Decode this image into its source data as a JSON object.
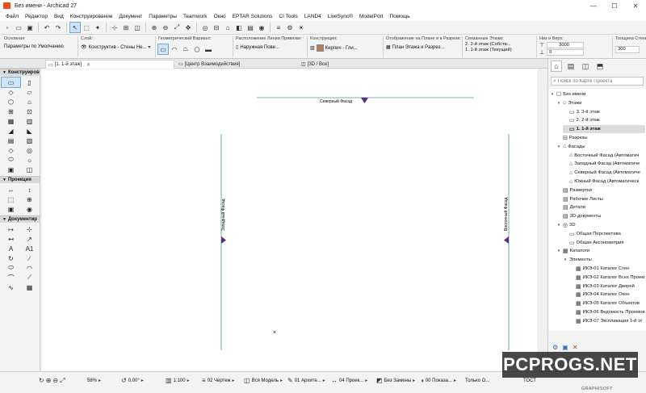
{
  "window": {
    "title": "Без имени - Archicad 27",
    "controls": [
      "—",
      "☐",
      "✕"
    ]
  },
  "menu": [
    "Файл",
    "Редактор",
    "Вид",
    "Конструирование",
    "Документ",
    "Параметры",
    "Teamwork",
    "Окно",
    "EPTAR Solutions",
    "CI Tools",
    "LAND4",
    "LiveSync®",
    "ModelPort",
    "Помощь"
  ],
  "infobox": {
    "groups": [
      {
        "label": "Основная:",
        "value": "Параметры по Умолчанию"
      },
      {
        "label": "Слой:",
        "value": "Конструктив - Стены Не..."
      },
      {
        "label": "Геометрический Вариант:",
        "value": ""
      },
      {
        "label": "Расположение Линии Привязки:",
        "value": "Наружная Пове..."
      },
      {
        "label": "Конструкция:",
        "value": "Кирпич - Гли..."
      },
      {
        "label": "Отображение на Плане и в Разрезе:",
        "value": "План Этажа и Разрез..."
      },
      {
        "label": "Связанные Этажи:",
        "value": "2. 2-й этаж (Собств...",
        "value2": "1. 1-й этаж (Текущий)"
      },
      {
        "label": "Низ и Верх:",
        "value": "3000",
        "value2": "0"
      },
      {
        "label": "Толщина Стены:",
        "value": "300"
      }
    ]
  },
  "tabs": [
    {
      "label": "[1. 1-й этаж]",
      "active": true
    },
    {
      "label": "[Центр Взаимодействия]",
      "active": false
    },
    {
      "label": "[3D / Все]",
      "active": false
    }
  ],
  "toolbox": {
    "sections": [
      {
        "title": "Конструиров",
        "tools": [
          "▭",
          "▯",
          "◇",
          "▱",
          "⬡",
          "⌂",
          "⊞",
          "⊡",
          "▦",
          "▥",
          "◢",
          "◣",
          "▤",
          "▧",
          "◇",
          "◎",
          "⬭",
          "☼",
          "▣",
          "◫"
        ]
      },
      {
        "title": "Проекция",
        "tools": [
          "↔",
          "↕",
          "⬚",
          "⊕",
          "▣",
          "◉"
        ]
      },
      {
        "title": "Документир",
        "tools": [
          "↦",
          "⊹",
          "↤",
          "↗",
          "A",
          "A1",
          "↻",
          "∕",
          "⬭",
          "◠",
          "⌒",
          "⟋",
          "∿",
          "▦"
        ]
      }
    ]
  },
  "canvas": {
    "labels": {
      "north": "Северный Фасад",
      "west": "Западный Фасад",
      "east": "Восточный Фасад"
    },
    "marker_color": "#5b2a86",
    "line_color": "#4a9a8c"
  },
  "navigator": {
    "search_placeholder": "Поиск по Карте Проекта",
    "items": [
      {
        "label": "Без имени",
        "level": 0,
        "icon": "☐",
        "toggle": "▾"
      },
      {
        "label": "Этажи",
        "level": 1,
        "icon": "⌂",
        "toggle": "▾"
      },
      {
        "label": "3. 3-й этаж",
        "level": 2,
        "icon": "▭",
        "toggle": ""
      },
      {
        "label": "2. 2-й этаж",
        "level": 2,
        "icon": "▭",
        "toggle": ""
      },
      {
        "label": "1. 1-й этаж",
        "level": 2,
        "icon": "▭",
        "toggle": "",
        "selected": true
      },
      {
        "label": "Разрезы",
        "level": 1,
        "icon": "⊟",
        "toggle": ""
      },
      {
        "label": "Фасады",
        "level": 1,
        "icon": "⌂",
        "toggle": "▾"
      },
      {
        "label": "Восточный Фасад (Автоматич",
        "level": 2,
        "icon": "⌂",
        "toggle": ""
      },
      {
        "label": "Западный Фасад (Автоматиче",
        "level": 2,
        "icon": "⌂",
        "toggle": ""
      },
      {
        "label": "Северный Фасад (Автоматиче",
        "level": 2,
        "icon": "⌂",
        "toggle": ""
      },
      {
        "label": "Южный Фасад (Автоматическ",
        "level": 2,
        "icon": "⌂",
        "toggle": ""
      },
      {
        "label": "Развертки",
        "level": 1,
        "icon": "▤",
        "toggle": ""
      },
      {
        "label": "Рабочие Листы",
        "level": 1,
        "icon": "▤",
        "toggle": ""
      },
      {
        "label": "Детали",
        "level": 1,
        "icon": "▤",
        "toggle": ""
      },
      {
        "label": "3D-документы",
        "level": 1,
        "icon": "▤",
        "toggle": ""
      },
      {
        "label": "3D",
        "level": 1,
        "icon": "◎",
        "toggle": "▾"
      },
      {
        "label": "Общая Перспектива",
        "level": 2,
        "icon": "▭",
        "toggle": ""
      },
      {
        "label": "Общая Аксонометрия",
        "level": 2,
        "icon": "▭",
        "toggle": ""
      },
      {
        "label": "Каталоги",
        "level": 1,
        "icon": "▦",
        "toggle": "▾"
      },
      {
        "label": "Элементы",
        "level": 2,
        "icon": "",
        "toggle": "▾"
      },
      {
        "label": "ИКЭ-01 Каталог Стен",
        "level": 3,
        "icon": "▦",
        "toggle": ""
      },
      {
        "label": "ИКЭ-02 Каталог Всех Проем",
        "level": 3,
        "icon": "▦",
        "toggle": ""
      },
      {
        "label": "ИКЭ-03 Каталог Дверей",
        "level": 3,
        "icon": "▦",
        "toggle": ""
      },
      {
        "label": "ИКЭ-04 Каталог Окон",
        "level": 3,
        "icon": "▦",
        "toggle": ""
      },
      {
        "label": "ИКЭ-05 Каталог Объектов",
        "level": 3,
        "icon": "▦",
        "toggle": ""
      },
      {
        "label": "ИКЭ-06 Ведомость Проемов",
        "level": 3,
        "icon": "▦",
        "toggle": ""
      },
      {
        "label": "ИКЭ-07 Экспликация 1-й эт",
        "level": 3,
        "icon": "▦",
        "toggle": ""
      }
    ]
  },
  "statusbar": {
    "zoom": "58%",
    "angle": "0,00°",
    "scale": "1:100",
    "layer_combo": "02 Чертеж",
    "model_view": "Вся Модель",
    "structure": "01 Архите...",
    "dimensions": "04 Проек...",
    "renovation": "Без Замены",
    "display": "00 Показа...",
    "only": "Только О...",
    "tost": "ТОСТ",
    "brand": "GRAPHISOFT"
  },
  "watermark": "PCPROGS.NET"
}
